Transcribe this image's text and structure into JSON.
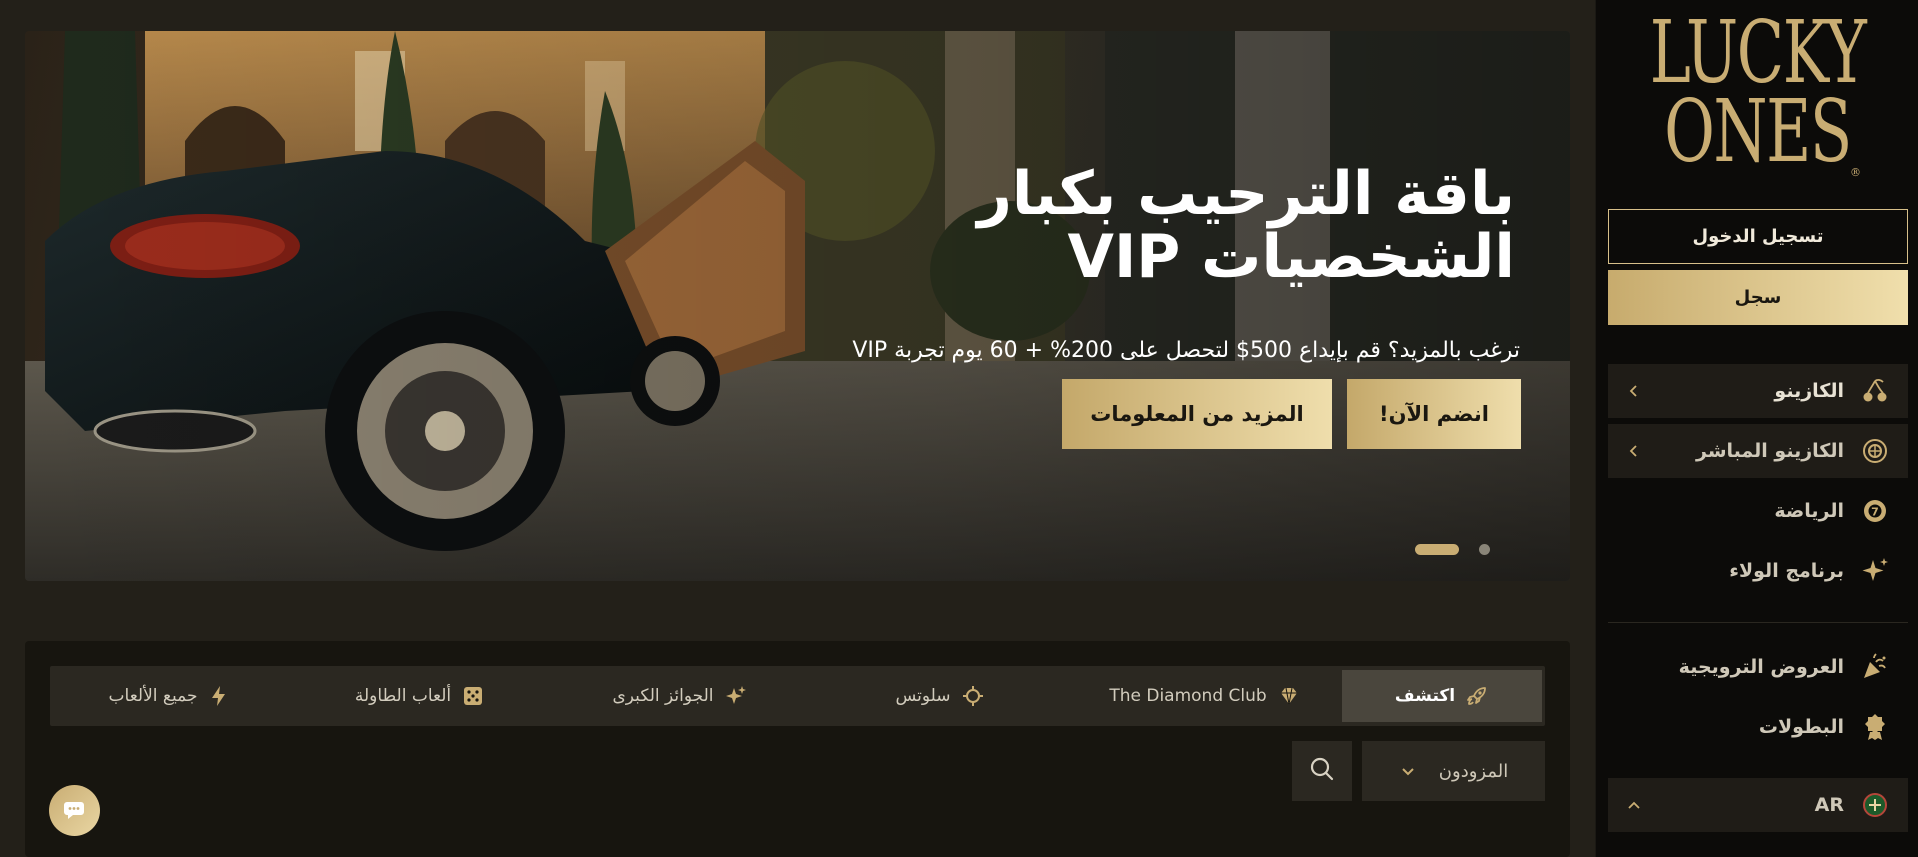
{
  "brand": {
    "logo_line1": "LUCKY",
    "logo_line2": "ONES",
    "logo_reg": "®",
    "gold": "#c9ad73"
  },
  "auth": {
    "login_label": "تسجيل الدخول",
    "register_label": "سجل"
  },
  "sidebar": {
    "items": [
      {
        "label": "الكازينو",
        "icon": "cherries-icon",
        "chevron": true
      },
      {
        "label": "الكازينو المباشر",
        "icon": "roulette-icon",
        "chevron": true
      },
      {
        "label": "الرياضة",
        "icon": "sports-ball-icon",
        "chevron": false
      },
      {
        "label": "برنامج الولاء",
        "icon": "sparkles-icon",
        "chevron": false
      },
      {
        "label": "العروض الترويجية",
        "icon": "party-popper-icon",
        "chevron": false
      },
      {
        "label": "البطولات",
        "icon": "award-badge-icon",
        "chevron": false
      }
    ],
    "language": {
      "code": "AR",
      "icon": "language-flag-icon"
    }
  },
  "hero": {
    "title": "باقة الترحيب بكبار الشخصيات VIP",
    "subtitle": "ترغب بالمزيد؟ قم بإيداع 500$ لتحصل على 200% + 60 يوم تجربة VIP",
    "join_label": "!انضم الآن",
    "more_label": "المزيد من المعلومات",
    "slides_total": 2,
    "slide_active": 1
  },
  "games": {
    "tabs": [
      {
        "label": "اكتشف",
        "icon": "rocket-icon",
        "active": true
      },
      {
        "label": "The Diamond Club",
        "icon": "diamond-icon",
        "active": false
      },
      {
        "label": "سلوتس",
        "icon": "slots-icon",
        "active": false
      },
      {
        "label": "الجوائز الكبرى",
        "icon": "jackpot-sparkle-icon",
        "active": false
      },
      {
        "label": "ألعاب الطاولة",
        "icon": "dice-icon",
        "active": false
      },
      {
        "label": "جميع الألعاب",
        "icon": "lightning-icon",
        "active": false
      }
    ],
    "provider_label": "المزودون"
  }
}
